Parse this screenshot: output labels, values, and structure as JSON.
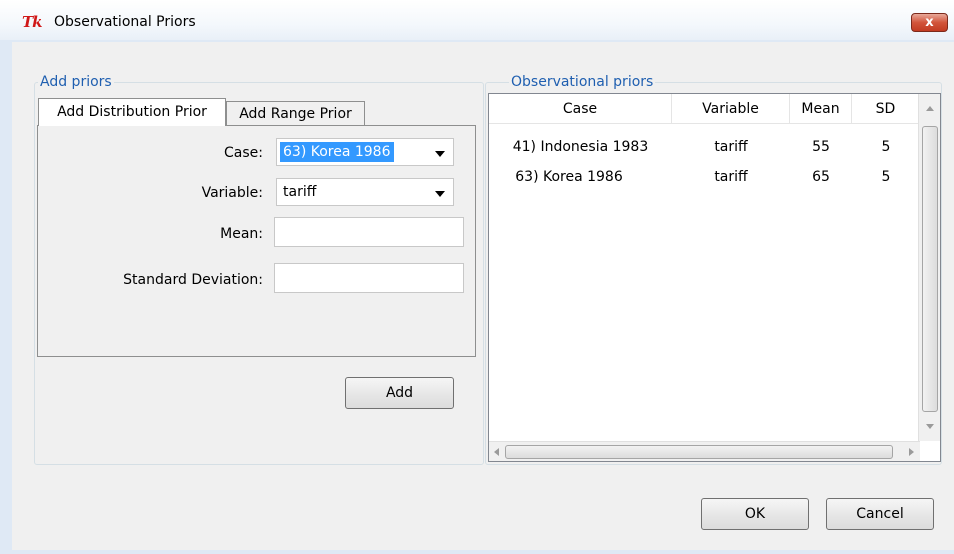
{
  "window": {
    "title": "Observational Priors",
    "app_icon": "Tk",
    "close_label": "x"
  },
  "add_priors": {
    "group_label": "Add priors",
    "tabs": [
      {
        "label": "Add Distribution Prior",
        "active": true
      },
      {
        "label": "Add Range Prior",
        "active": false
      }
    ],
    "case_label": "Case:",
    "case_value": "63) Korea 1986",
    "variable_label": "Variable:",
    "variable_value": "tariff",
    "mean_label": "Mean:",
    "mean_value": "",
    "sd_label": "Standard Deviation:",
    "sd_value": "",
    "add_button": "Add"
  },
  "observational_priors": {
    "group_label": "Observational priors",
    "columns": [
      "Case",
      "Variable",
      "Mean",
      "SD"
    ],
    "rows": [
      {
        "case": "41) Indonesia 1983",
        "variable": "tariff",
        "mean": "55",
        "sd": "5"
      },
      {
        "case": "63) Korea 1986",
        "variable": "tariff",
        "mean": "65",
        "sd": "5"
      }
    ]
  },
  "buttons": {
    "ok": "OK",
    "cancel": "Cancel"
  },
  "colors": {
    "group_label": "#1f5fb0",
    "selection": "#3399ff",
    "close_button": "#c23b22"
  },
  "icons": {
    "app": "tk-feather-icon",
    "close": "close-icon",
    "dropdown": "chevron-down-icon"
  }
}
